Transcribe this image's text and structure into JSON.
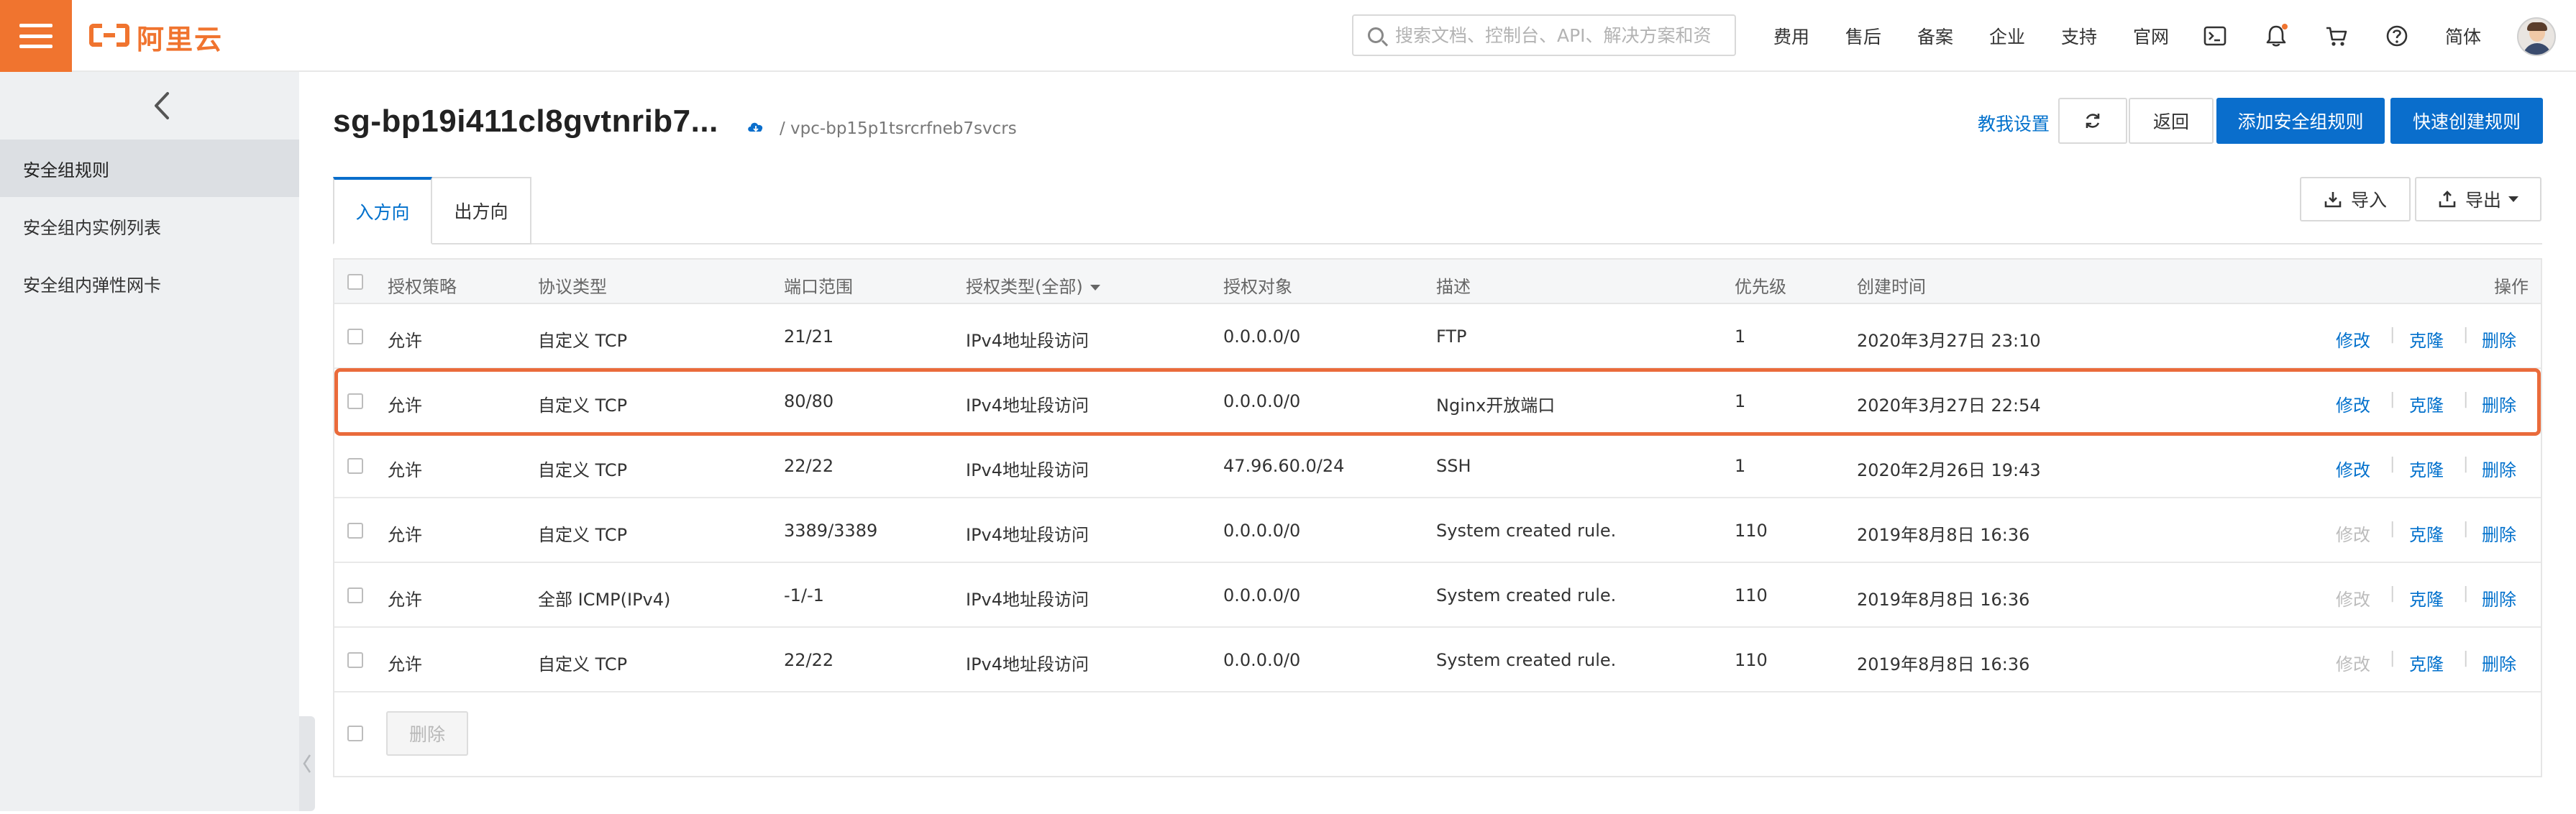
{
  "brand": {
    "logo_text": "阿里云",
    "accent": "#f0742f"
  },
  "search": {
    "placeholder": "搜索文档、控制台、API、解决方案和资源"
  },
  "topnav": [
    "费用",
    "售后",
    "备案",
    "企业",
    "支持",
    "官网"
  ],
  "topnav_lang": "简体",
  "topnav_icons": [
    "terminal-icon",
    "bell-icon",
    "cart-icon",
    "help-icon"
  ],
  "sidebar": {
    "items": [
      {
        "label": "安全组规则",
        "active": true
      },
      {
        "label": "安全组内实例列表",
        "active": false
      },
      {
        "label": "安全组内弹性网卡",
        "active": false
      }
    ]
  },
  "header": {
    "title": "sg-bp19i411cl8gvtnrib7...",
    "vpc": "/ vpc-bp15p1tsrcrfneb7svcrs",
    "help_link": "教我设置",
    "back_label": "返回",
    "add_rule_label": "添加安全组规则",
    "quick_create_label": "快速创建规则",
    "import_label": "导入",
    "export_label": "导出"
  },
  "tabs": [
    {
      "label": "入方向",
      "active": true
    },
    {
      "label": "出方向",
      "active": false
    }
  ],
  "table": {
    "columns": [
      "授权策略",
      "协议类型",
      "端口范围",
      "授权类型(全部)",
      "授权对象",
      "描述",
      "优先级",
      "创建时间",
      "操作"
    ],
    "ops": {
      "edit": "修改",
      "clone": "克隆",
      "delete": "删除"
    },
    "rows": [
      {
        "policy": "允许",
        "protocol": "自定义 TCP",
        "port": "21/21",
        "auth_type": "IPv4地址段访问",
        "object": "0.0.0.0/0",
        "desc": "FTP",
        "priority": "1",
        "created": "2020年3月27日 23:10",
        "edit_enabled": true
      },
      {
        "policy": "允许",
        "protocol": "自定义 TCP",
        "port": "80/80",
        "auth_type": "IPv4地址段访问",
        "object": "0.0.0.0/0",
        "desc": "Nginx开放端口",
        "priority": "1",
        "created": "2020年3月27日 22:54",
        "edit_enabled": true
      },
      {
        "policy": "允许",
        "protocol": "自定义 TCP",
        "port": "22/22",
        "auth_type": "IPv4地址段访问",
        "object": "47.96.60.0/24",
        "desc": "SSH",
        "priority": "1",
        "created": "2020年2月26日 19:43",
        "edit_enabled": true
      },
      {
        "policy": "允许",
        "protocol": "自定义 TCP",
        "port": "3389/3389",
        "auth_type": "IPv4地址段访问",
        "object": "0.0.0.0/0",
        "desc": "System created rule.",
        "priority": "110",
        "created": "2019年8月8日 16:36",
        "edit_enabled": false
      },
      {
        "policy": "允许",
        "protocol": "全部 ICMP(IPv4)",
        "port": "-1/-1",
        "auth_type": "IPv4地址段访问",
        "object": "0.0.0.0/0",
        "desc": "System created rule.",
        "priority": "110",
        "created": "2019年8月8日 16:36",
        "edit_enabled": false
      },
      {
        "policy": "允许",
        "protocol": "自定义 TCP",
        "port": "22/22",
        "auth_type": "IPv4地址段访问",
        "object": "0.0.0.0/0",
        "desc": "System created rule.",
        "priority": "110",
        "created": "2019年8月8日 16:36",
        "edit_enabled": false
      }
    ],
    "highlighted_row": 2,
    "footer_delete_label": "删除"
  },
  "colors": {
    "primary": "#0a6ecc",
    "link": "#0070cc",
    "highlight": "#ea6b3b"
  }
}
